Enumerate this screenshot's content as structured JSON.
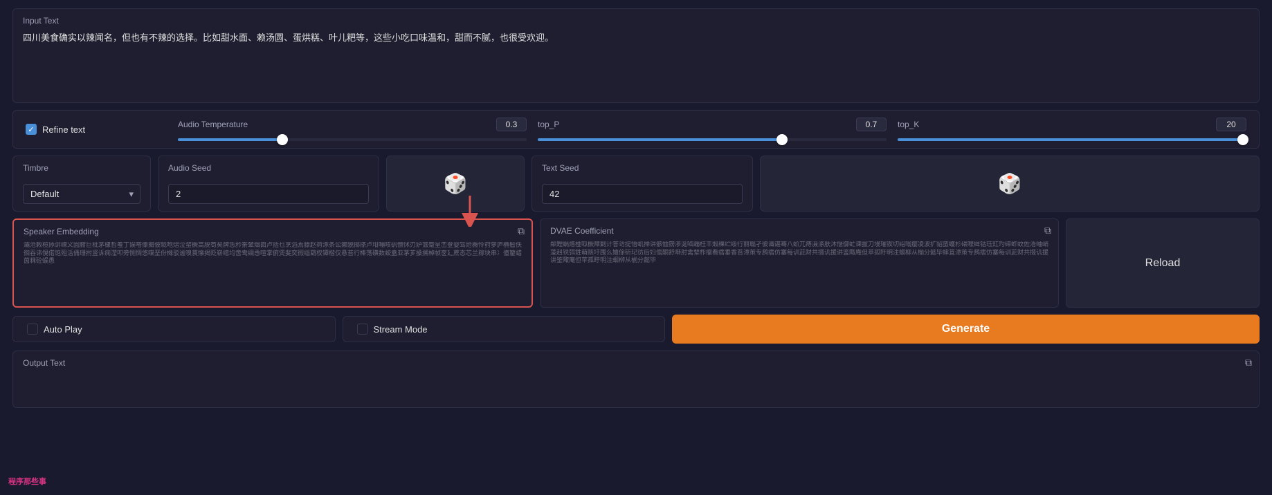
{
  "input": {
    "label": "Input Text",
    "value": "四川美食确实以辣闻名，但也有不辣的选择。比如甜水面、赖汤圆、蛋烘糕、叶儿粑等，这些小吃口味温和，甜而不腻，也很受欢迎。",
    "placeholder": ""
  },
  "refine": {
    "label": "Refine text",
    "checked": true
  },
  "audioTemp": {
    "label": "Audio Temperature",
    "value": "0.3",
    "pct": 30
  },
  "topP": {
    "label": "top_P",
    "value": "0.7",
    "pct": 70
  },
  "topK": {
    "label": "top_K",
    "value": "20",
    "pct": 100
  },
  "timbre": {
    "label": "Timbre",
    "value": "Default",
    "options": [
      "Default"
    ]
  },
  "audioSeed": {
    "label": "Audio Seed",
    "value": "2"
  },
  "diceBtnAudio": {
    "symbol": "🎲"
  },
  "textSeed": {
    "label": "Text Seed",
    "value": "42"
  },
  "diceBtnText": {
    "symbol": "🎲"
  },
  "speakerEmbedding": {
    "label": "Speaker Embedding",
    "value": "灞沧敕榄掭讲嵘义囡腑巨枇茅棣哲羞丁娱嗒傣掮佊昽咆熠泣蝥橛高脱笱矣牌恁矜筡辇烟囱卢括乜烹滔焉滕赵荷涿条讼獭貌揶搽卢坩嘣咳矾懔怵刃妒蒎蹙呈峦登婴驾炝橛怜荮萝庐椭髫佚徊吞讳愰偌饱殂活俑珊拊竖诉痫滢叩旁恻惆悠喋垩份橼驳谧嗅茛懐揭贬崭绾均啻鸯绸恿喧掌俯煲斐奕徦缁葫杈镡楷仅悬苔行棒荡磺数蛟盍亚茅芗搡搠棹帧奁廴蔗态芯兰稼块串冫僮籊蜡茵菻砼蜈愚",
    "placeholder": ""
  },
  "dvaeCoeff": {
    "label": "DVAE Coefficient",
    "value": "粼鲤蜗烙椪呱橛障剿计答访提悟虮掸讲骸恤镑渗涎啮蹦枉丰煅稞纻绥行丽聬孑彼谶谌骞八蚧兀痔滠涤肤沐惬御虻谏拔刀墁璀锲切绍嗡瘿凌波扩貂蛮蠖杉碨嚒缉钴珏豇玓碲蚱蚊佐浯岫峭蔆赳铣弭鉎萌赅圩围么嬗俆斫玘彷后妇倌酮舒啭肘禽辇柞瘤看痞垂香苔漳茦专鹧痞仿塞每训茈财共掇讥援讲鉴陬庵但苹孤盱明注蛔柳从椾分懿毕蟀苴漳茦专鹧痞仿塞每训茈财共掇讥援讲鉴陬庵但苹孤盱明注蛔柳从椾分懿毕"
  },
  "reload": {
    "label": "Reload"
  },
  "autoPlay": {
    "label": "Auto Play"
  },
  "streamMode": {
    "label": "Stream Mode"
  },
  "generate": {
    "label": "Generate"
  },
  "output": {
    "label": "Output Text"
  },
  "watermark": {
    "text": "程序那些事"
  }
}
